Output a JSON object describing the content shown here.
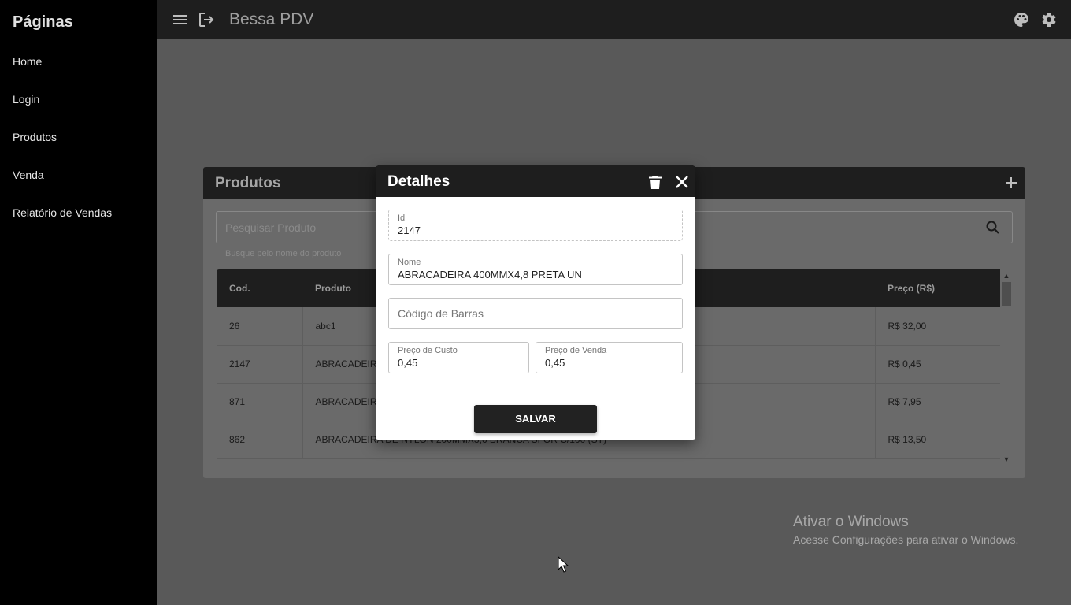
{
  "sidebar": {
    "title": "Páginas",
    "items": [
      {
        "label": "Home"
      },
      {
        "label": "Login"
      },
      {
        "label": "Produtos"
      },
      {
        "label": "Venda"
      },
      {
        "label": "Relatório de Vendas"
      }
    ]
  },
  "topbar": {
    "title": "Bessa PDV",
    "icons": [
      "menu-icon",
      "logout-icon",
      "palette-icon",
      "gear-icon"
    ]
  },
  "produtos": {
    "title": "Produtos",
    "search_placeholder": "Pesquisar Produto",
    "search_hint": "Busque pelo nome do produto",
    "columns": {
      "cod": "Cod.",
      "produto": "Produto",
      "preco": "Preço (R$)"
    },
    "rows": [
      {
        "cod": "26",
        "produto": "abc1",
        "preco": "R$ 32,00"
      },
      {
        "cod": "2147",
        "produto": "ABRACADEIRA 400MMX4,8 PRETA UN",
        "preco": "R$ 0,45"
      },
      {
        "cod": "871",
        "produto": "ABRACADEIRA",
        "preco": "R$ 7,95"
      },
      {
        "cod": "862",
        "produto": "ABRACADEIRA DE NYLON 200MMX3,6 BRANCA SFOR C/100 (ST)",
        "preco": "R$ 13,50"
      }
    ]
  },
  "dialog": {
    "title": "Detalhes",
    "id_label": "Id",
    "id_value": "2147",
    "nome_label": "Nome",
    "nome_value": "ABRACADEIRA 400MMX4,8 PRETA UN",
    "barcode_placeholder": "Código de Barras",
    "custo_label": "Preço de Custo",
    "custo_value": "0,45",
    "venda_label": "Preço de Venda",
    "venda_value": "0,45",
    "save_label": "SALVAR"
  },
  "watermark": {
    "title": "Ativar o Windows",
    "subtitle": "Acesse Configurações para ativar o Windows."
  },
  "colors": {
    "bar": "#1e1e1e",
    "sidebar": "#000000",
    "overlay": "#595959"
  }
}
